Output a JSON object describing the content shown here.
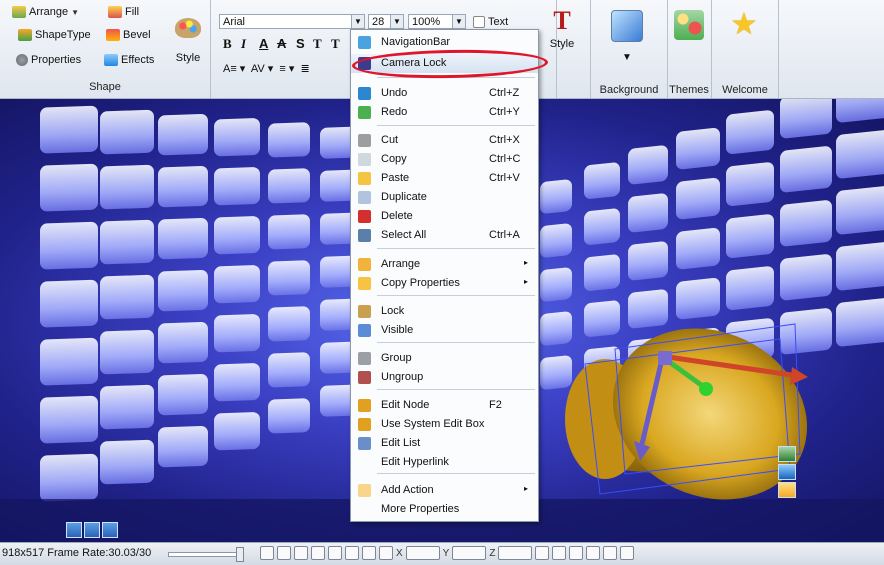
{
  "ribbon": {
    "shape": {
      "arrange": "Arrange",
      "fill": "Fill",
      "shape_type": "ShapeType",
      "bevel": "Bevel",
      "properties": "Properties",
      "effects": "Effects",
      "style": "Style",
      "label": "Shape"
    },
    "font": {
      "family": "Arial",
      "size": "28",
      "zoom": "100%",
      "text": "Text",
      "bold": "B",
      "italic": "I",
      "a1": "A",
      "a2": "A",
      "s": "S",
      "tt": "T"
    },
    "text_style": "Style",
    "background": "Background",
    "themes": "Themes",
    "welcome": "Welcome"
  },
  "menu": {
    "items": [
      {
        "label": "NavigationBar",
        "shortcut": "",
        "submenu": false
      },
      {
        "label": "Camera Lock",
        "shortcut": "",
        "submenu": false
      },
      {
        "label": "Undo",
        "shortcut": "Ctrl+Z",
        "submenu": false
      },
      {
        "label": "Redo",
        "shortcut": "Ctrl+Y",
        "submenu": false
      },
      {
        "label": "Cut",
        "shortcut": "Ctrl+X",
        "submenu": false
      },
      {
        "label": "Copy",
        "shortcut": "Ctrl+C",
        "submenu": false
      },
      {
        "label": "Paste",
        "shortcut": "Ctrl+V",
        "submenu": false
      },
      {
        "label": "Duplicate",
        "shortcut": "",
        "submenu": false
      },
      {
        "label": "Delete",
        "shortcut": "",
        "submenu": false
      },
      {
        "label": "Select All",
        "shortcut": "Ctrl+A",
        "submenu": false
      },
      {
        "label": "Arrange",
        "shortcut": "",
        "submenu": true
      },
      {
        "label": "Copy Properties",
        "shortcut": "",
        "submenu": true
      },
      {
        "label": "Lock",
        "shortcut": "",
        "submenu": false
      },
      {
        "label": "Visible",
        "shortcut": "",
        "submenu": false
      },
      {
        "label": "Group",
        "shortcut": "",
        "submenu": false
      },
      {
        "label": "Ungroup",
        "shortcut": "",
        "submenu": false
      },
      {
        "label": "Edit Node",
        "shortcut": "F2",
        "submenu": false
      },
      {
        "label": "Use System Edit Box",
        "shortcut": "",
        "submenu": false
      },
      {
        "label": "Edit List",
        "shortcut": "",
        "submenu": false
      },
      {
        "label": "Edit Hyperlink",
        "shortcut": "",
        "submenu": false
      },
      {
        "label": "Add Action",
        "shortcut": "",
        "submenu": true
      },
      {
        "label": "More Properties",
        "shortcut": "",
        "submenu": false
      }
    ],
    "arrow": "▸"
  },
  "status": {
    "text": "918x517  Frame Rate:30.03/30",
    "x_label": "X",
    "y_label": "Y",
    "z_label": "Z"
  },
  "colors": {
    "highlight_ring": "#e0152a",
    "viewport_bg": "#3b40c4",
    "cylinder": "#d9a720"
  }
}
